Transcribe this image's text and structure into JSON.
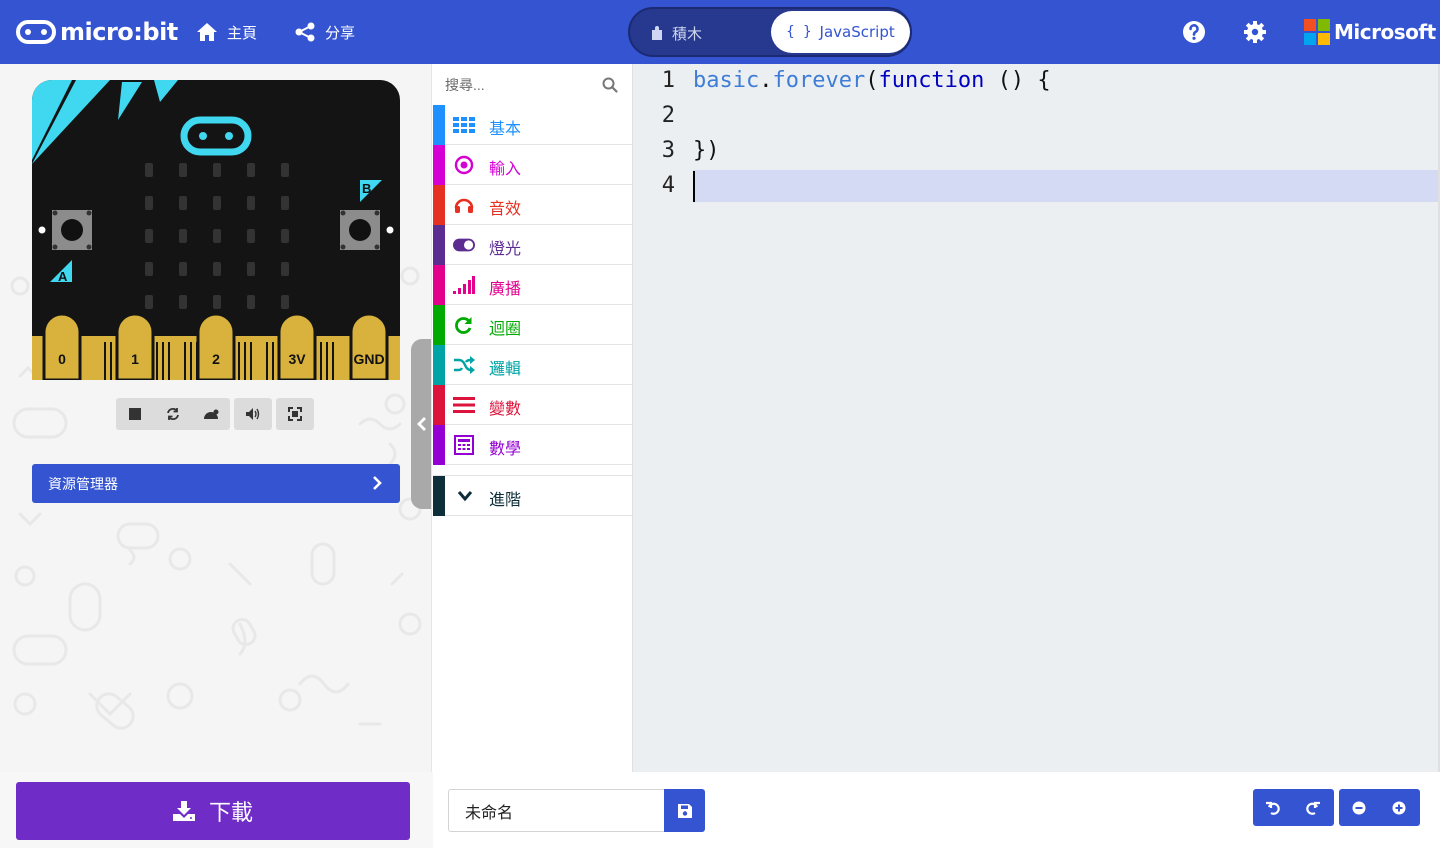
{
  "header": {
    "logo_text": "micro:bit",
    "home_label": "主頁",
    "share_label": "分享",
    "toggle": {
      "blocks_label": "積木",
      "js_braces": "{ }",
      "js_label": "JavaScript"
    },
    "help_icon": "question-circle-icon",
    "settings_icon": "gear-icon",
    "brand": "Microsoft",
    "colors": {
      "bar": "#3454d1",
      "toggle_bg": "#27398e"
    }
  },
  "simulator": {
    "pins": [
      "0",
      "1",
      "2",
      "3V",
      "GND"
    ],
    "button_a": "A",
    "button_b": "B",
    "controls": [
      "stop-icon",
      "restart-icon",
      "slow-mo-icon",
      "mute-icon",
      "fullscreen-icon"
    ],
    "explorer_label": "資源管理器"
  },
  "toolbox": {
    "search_placeholder": "搜尋...",
    "categories": [
      {
        "label": "基本",
        "color": "#1e90ff",
        "icon": "grid-icon"
      },
      {
        "label": "輸入",
        "color": "#d400d4",
        "icon": "target-icon"
      },
      {
        "label": "音效",
        "color": "#e63022",
        "icon": "headphones-icon"
      },
      {
        "label": "燈光",
        "color": "#5c2d91",
        "icon": "toggle-icon"
      },
      {
        "label": "廣播",
        "color": "#e3008c",
        "icon": "signal-icon"
      },
      {
        "label": "迴圈",
        "color": "#00aa00",
        "icon": "refresh-icon"
      },
      {
        "label": "邏輯",
        "color": "#00a4a6",
        "icon": "shuffle-icon"
      },
      {
        "label": "變數",
        "color": "#dc143c",
        "icon": "list-icon"
      },
      {
        "label": "數學",
        "color": "#9400d3",
        "icon": "calculator-icon"
      }
    ],
    "advanced_label": "進階"
  },
  "editor": {
    "line_numbers": [
      "1",
      "2",
      "3",
      "4"
    ],
    "code": {
      "obj": "basic",
      "dot": ".",
      "method": "forever",
      "paren_open": "(",
      "keyword": "function",
      "rest": " () {",
      "close": "})"
    }
  },
  "footer": {
    "download_label": "下載",
    "project_name": "未命名",
    "undo_icon": "undo-icon",
    "redo_icon": "redo-icon",
    "zoom_out_icon": "zoom-out-icon",
    "zoom_in_icon": "zoom-in-icon"
  }
}
